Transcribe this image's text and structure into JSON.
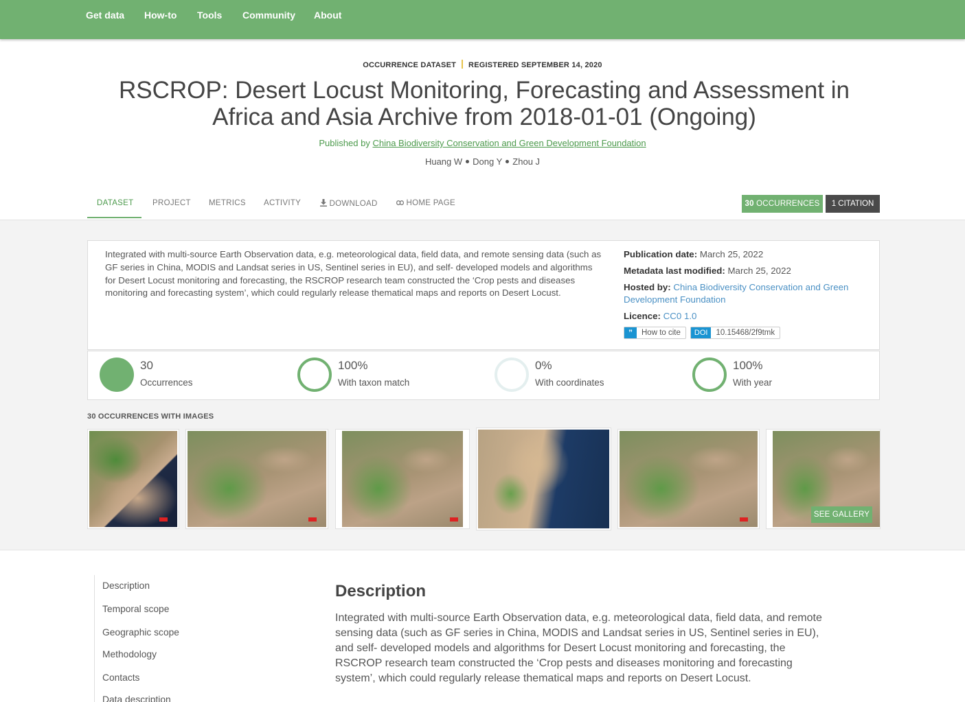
{
  "nav": {
    "items": [
      "Get data",
      "How-to",
      "Tools",
      "Community",
      "About"
    ]
  },
  "header": {
    "type_label": "OCCURRENCE DATASET",
    "registered_label": "REGISTERED SEPTEMBER 14, 2020",
    "title_line1": "RSCROP: Desert Locust Monitoring, Forecasting and Assessment in",
    "title_line2": "Africa and Asia Archive from 2018-01-01 (Ongoing)",
    "published_prefix": "Published by",
    "publisher": "China Biodiversity Conservation and Green Development Foundation",
    "authors": [
      "Huang W",
      "Dong Y",
      "Zhou J"
    ]
  },
  "tabs": {
    "dataset": "DATASET",
    "project": "PROJECT",
    "metrics": "METRICS",
    "activity": "ACTIVITY",
    "download": "DOWNLOAD",
    "home_page": "HOME PAGE",
    "occurrences_count": "30",
    "occurrences_label": "OCCURRENCES",
    "citation_label": "1 CITATION"
  },
  "summary": {
    "description": "Integrated with multi-source Earth Observation data, e.g. meteorological data, field data, and remote sensing data (such as GF series in China, MODIS and Landsat series in US, Sentinel series in EU), and self- developed models and algorithms for Desert Locust monitoring and forecasting, the RSCROP research team constructed the ‘Crop pests and diseases monitoring and forecasting system’, which could regularly release thematical maps and reports on Desert Locust.",
    "publication_date_label": "Publication date:",
    "publication_date": "March 25, 2022",
    "modified_label": "Metadata last modified:",
    "modified": "March 25, 2022",
    "hosted_label": "Hosted by:",
    "hosted": "China Biodiversity Conservation and Green Development Foundation",
    "licence_label": "Licence:",
    "licence": "CC0 1.0",
    "cite_label": "How to cite",
    "doi_label": "DOI",
    "doi": "10.15468/2f9tmk"
  },
  "metrics": [
    {
      "value": "30",
      "label": "Occurrences",
      "fill": 1.0
    },
    {
      "value": "100%",
      "label": "With taxon match",
      "fill": 1.0
    },
    {
      "value": "0%",
      "label": "With coordinates",
      "fill": 0.0
    },
    {
      "value": "100%",
      "label": "With year",
      "fill": 1.0
    }
  ],
  "gallery": {
    "title": "30 OCCURRENCES WITH IMAGES",
    "see_gallery": "SEE GALLERY"
  },
  "toc": [
    "Description",
    "Temporal scope",
    "Geographic scope",
    "Methodology",
    "Contacts",
    "Data description"
  ],
  "description": {
    "title": "Description",
    "body": "Integrated with multi-source Earth Observation data, e.g. meteorological data, field data, and remote sensing data (such as GF series in China, MODIS and Landsat series in US, Sentinel series in EU), and self- developed models and algorithms for Desert Locust monitoring and forecasting, the RSCROP research team constructed the ‘Crop pests and diseases monitoring and forecasting system’, which could regularly release thematical maps and reports on Desert Locust."
  },
  "colors": {
    "brand_green": "#71b171",
    "link_blue": "#4a90c4",
    "doi_blue": "#1a94d2",
    "dark_button": "#4a4a4a"
  }
}
